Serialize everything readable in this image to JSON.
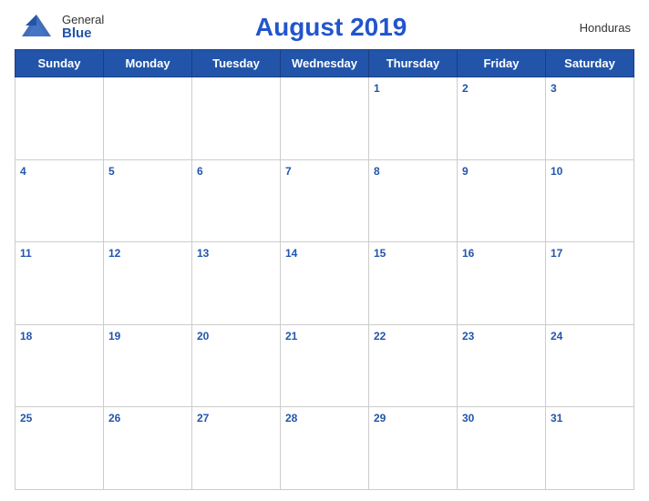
{
  "header": {
    "logo_general": "General",
    "logo_blue": "Blue",
    "title": "August 2019",
    "country": "Honduras"
  },
  "days_of_week": [
    "Sunday",
    "Monday",
    "Tuesday",
    "Wednesday",
    "Thursday",
    "Friday",
    "Saturday"
  ],
  "weeks": [
    [
      null,
      null,
      null,
      null,
      1,
      2,
      3
    ],
    [
      4,
      5,
      6,
      7,
      8,
      9,
      10
    ],
    [
      11,
      12,
      13,
      14,
      15,
      16,
      17
    ],
    [
      18,
      19,
      20,
      21,
      22,
      23,
      24
    ],
    [
      25,
      26,
      27,
      28,
      29,
      30,
      31
    ]
  ]
}
